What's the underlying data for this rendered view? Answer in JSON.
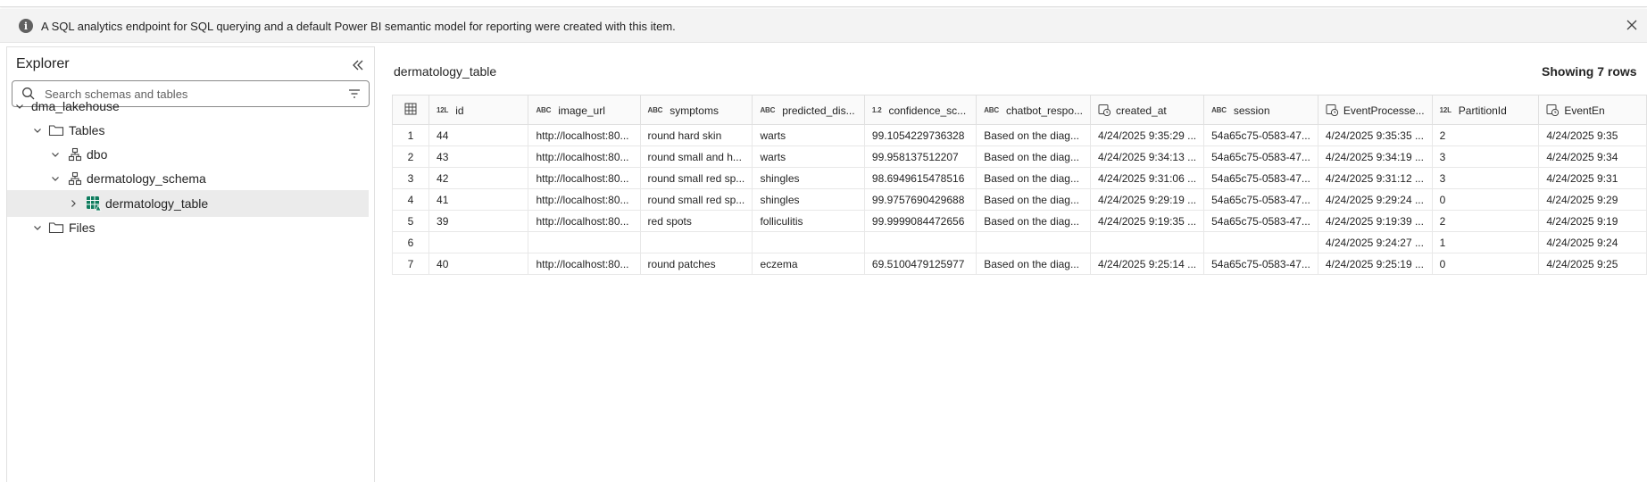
{
  "info_bar": {
    "message": "A SQL analytics endpoint for SQL querying and a default Power BI semantic model for reporting were created with this item.",
    "icon": "info-icon",
    "close_icon": "close-icon"
  },
  "explorer": {
    "title": "Explorer",
    "search_placeholder": "Search schemas and tables",
    "tree": {
      "lakehouse": "dma_lakehouse",
      "tables": "Tables",
      "dbo": "dbo",
      "schema": "dermatology_schema",
      "table": "dermatology_table",
      "files": "Files"
    }
  },
  "main": {
    "table_name": "dermatology_table",
    "row_count": "Showing 7 rows",
    "columns": [
      {
        "type": "12L",
        "name": "id"
      },
      {
        "type": "ABC",
        "name": "image_url"
      },
      {
        "type": "ABC",
        "name": "symptoms"
      },
      {
        "type": "ABC",
        "name": "predicted_dis..."
      },
      {
        "type": "1.2",
        "name": "confidence_sc..."
      },
      {
        "type": "ABC",
        "name": "chatbot_respo..."
      },
      {
        "type": "clock",
        "name": "created_at"
      },
      {
        "type": "ABC",
        "name": "session"
      },
      {
        "type": "clock",
        "name": "EventProcesse..."
      },
      {
        "type": "12L",
        "name": "PartitionId"
      },
      {
        "type": "clock",
        "name": "EventEn"
      }
    ],
    "rows": [
      {
        "n": "1",
        "cells": [
          "44",
          "http://localhost:80...",
          "round hard skin",
          "warts",
          "99.1054229736328",
          "Based on the diag...",
          "4/24/2025 9:35:29 ...",
          "54a65c75-0583-47...",
          "4/24/2025 9:35:35 ...",
          "2",
          "4/24/2025 9:35"
        ]
      },
      {
        "n": "2",
        "cells": [
          "43",
          "http://localhost:80...",
          "round small and h...",
          "warts",
          "99.958137512207",
          "Based on the diag...",
          "4/24/2025 9:34:13 ...",
          "54a65c75-0583-47...",
          "4/24/2025 9:34:19 ...",
          "3",
          "4/24/2025 9:34"
        ]
      },
      {
        "n": "3",
        "cells": [
          "42",
          "http://localhost:80...",
          "round small red sp...",
          "shingles",
          "98.6949615478516",
          "Based on the diag...",
          "4/24/2025 9:31:06 ...",
          "54a65c75-0583-47...",
          "4/24/2025 9:31:12 ...",
          "3",
          "4/24/2025 9:31"
        ]
      },
      {
        "n": "4",
        "cells": [
          "41",
          "http://localhost:80...",
          "round small red sp...",
          "shingles",
          "99.9757690429688",
          "Based on the diag...",
          "4/24/2025 9:29:19 ...",
          "54a65c75-0583-47...",
          "4/24/2025 9:29:24 ...",
          "0",
          "4/24/2025 9:29"
        ]
      },
      {
        "n": "5",
        "cells": [
          "39",
          "http://localhost:80...",
          "red spots",
          "folliculitis",
          "99.9999084472656",
          "Based on the diag...",
          "4/24/2025 9:19:35 ...",
          "54a65c75-0583-47...",
          "4/24/2025 9:19:39 ...",
          "2",
          "4/24/2025 9:19"
        ]
      },
      {
        "n": "6",
        "cells": [
          "",
          "",
          "",
          "",
          "",
          "",
          "",
          "",
          "4/24/2025 9:24:27 ...",
          "1",
          "4/24/2025 9:24"
        ]
      },
      {
        "n": "7",
        "cells": [
          "40",
          "http://localhost:80...",
          "round patches",
          "eczema",
          "69.5100479125977",
          "Based on the diag...",
          "4/24/2025 9:25:14 ...",
          "54a65c75-0583-47...",
          "4/24/2025 9:25:19 ...",
          "0",
          "4/24/2025 9:25"
        ]
      }
    ]
  },
  "colors": {
    "accent": "#0f7c5e",
    "selected_bg": "#ebebeb",
    "info_bg": "#f3f3f3"
  }
}
